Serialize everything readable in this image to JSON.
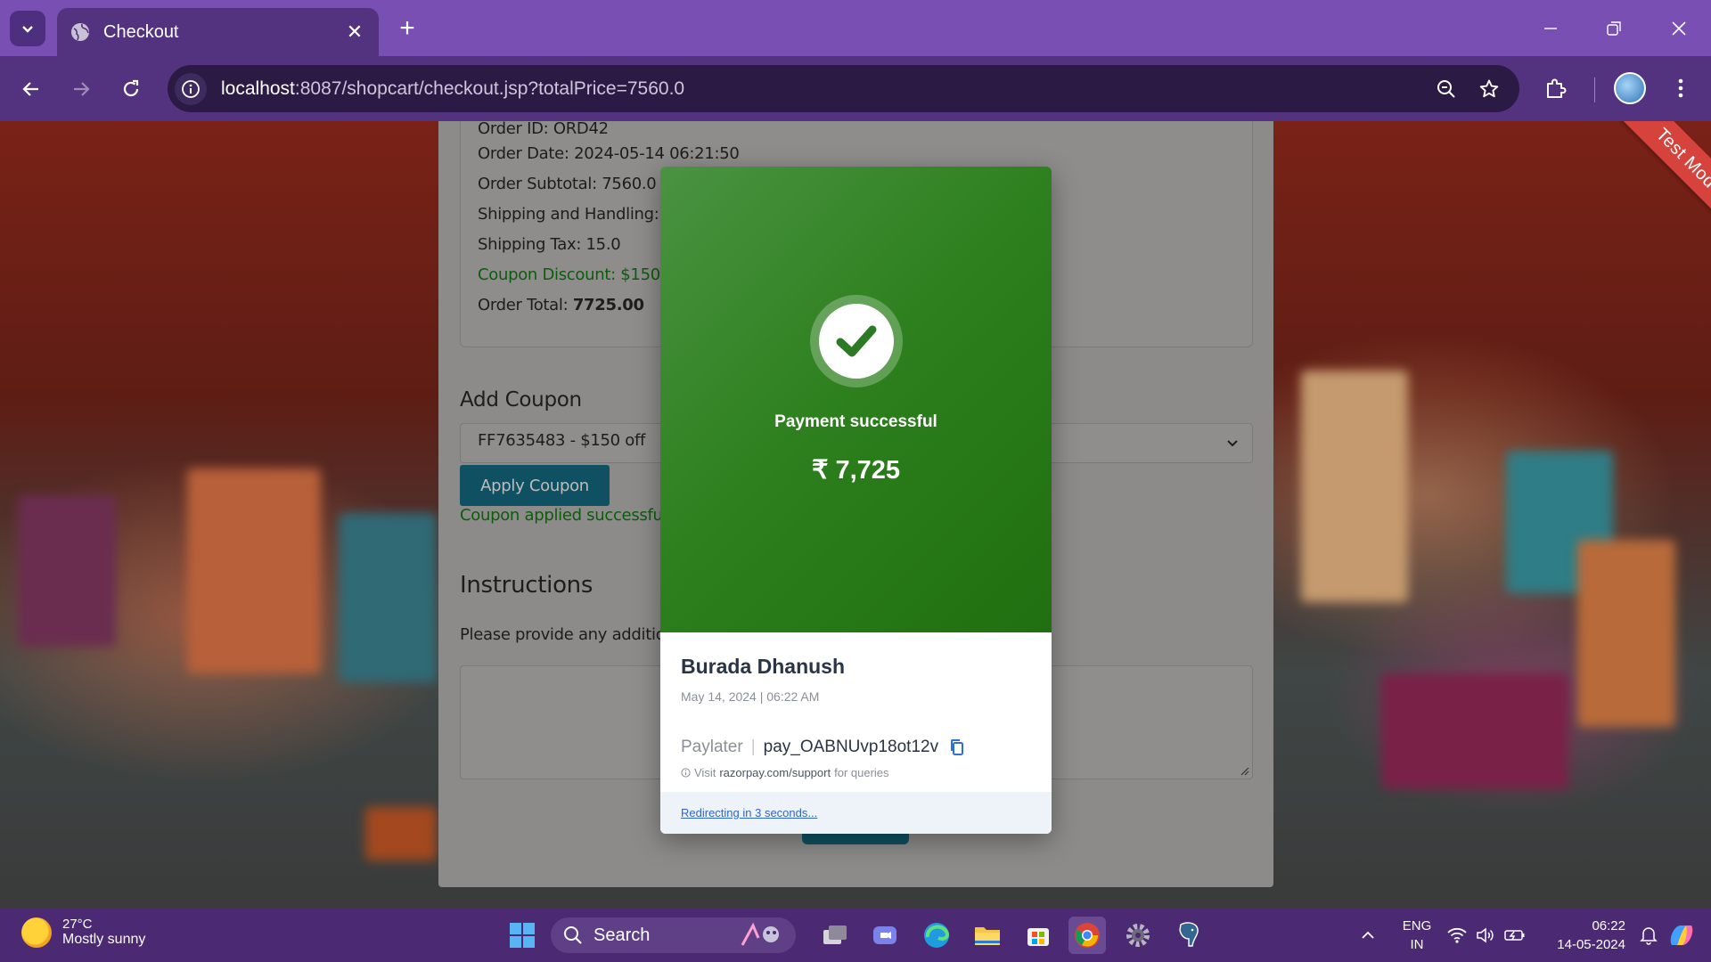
{
  "browser": {
    "tab_title": "Checkout",
    "url_host": "localhost",
    "url_rest": ":8087/shopcart/checkout.jsp?totalPrice=7560.0"
  },
  "page": {
    "test_mode_label": "Test Mode",
    "order": {
      "order_id": "Order ID: ORD42",
      "order_date": "Order Date: 2024-05-14 06:21:50",
      "subtotal": "Order Subtotal: 7560.0",
      "shipping": "Shipping and Handling:",
      "shipping_tax": "Shipping Tax: 15.0",
      "coupon_discount": "Coupon Discount: $150",
      "total_label": "Order Total: ",
      "total_value": "7725.00"
    },
    "coupon": {
      "heading": "Add Coupon",
      "selected": "FF7635483 - $150 off",
      "apply_label": "Apply Coupon",
      "applied_msg": "Coupon applied successfull"
    },
    "instructions": {
      "heading": "Instructions",
      "prompt": "Please provide any additio"
    }
  },
  "modal": {
    "status": "Payment successful",
    "amount": "₹ 7,725",
    "customer": "Burada Dhanush",
    "datetime": "May 14, 2024 | 06:22 AM",
    "method": "Paylater",
    "payment_id": "pay_OABNUvp18ot12v",
    "support_prefix": "Visit",
    "support_domain": "razorpay.com/support",
    "support_suffix": "for queries",
    "redirect": "Redirecting in 3 seconds..."
  },
  "taskbar": {
    "temperature": "27°C",
    "condition": "Mostly sunny",
    "search_label": "Search",
    "lang_top": "ENG",
    "lang_bottom": "IN",
    "time": "06:22",
    "date": "14-05-2024"
  },
  "colors": {
    "chrome_purple": "#7a4fb4",
    "modal_green": "#2c7f1c",
    "button_teal": "#0f5162"
  }
}
